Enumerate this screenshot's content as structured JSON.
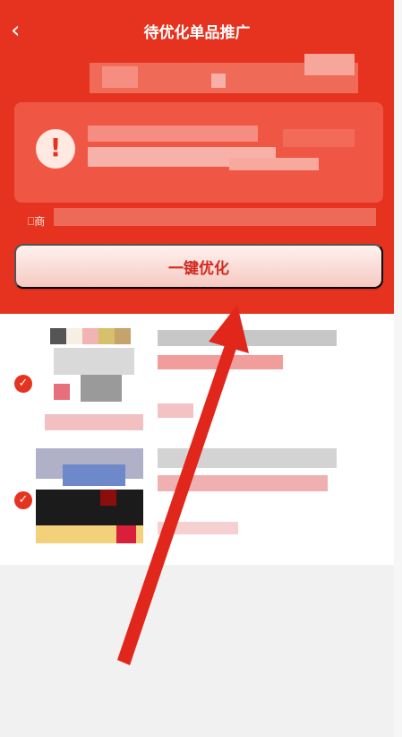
{
  "header": {
    "back_icon": "chevron-left-icon",
    "title": "待优化单品推广",
    "small_label": "商",
    "optimize_button": "一键优化"
  },
  "colors": {
    "primary": "#e5331f",
    "card": "#f05644",
    "button_text": "#d22a1f"
  },
  "list": {
    "rows": [
      {
        "selected": true
      },
      {
        "selected": true
      }
    ]
  }
}
